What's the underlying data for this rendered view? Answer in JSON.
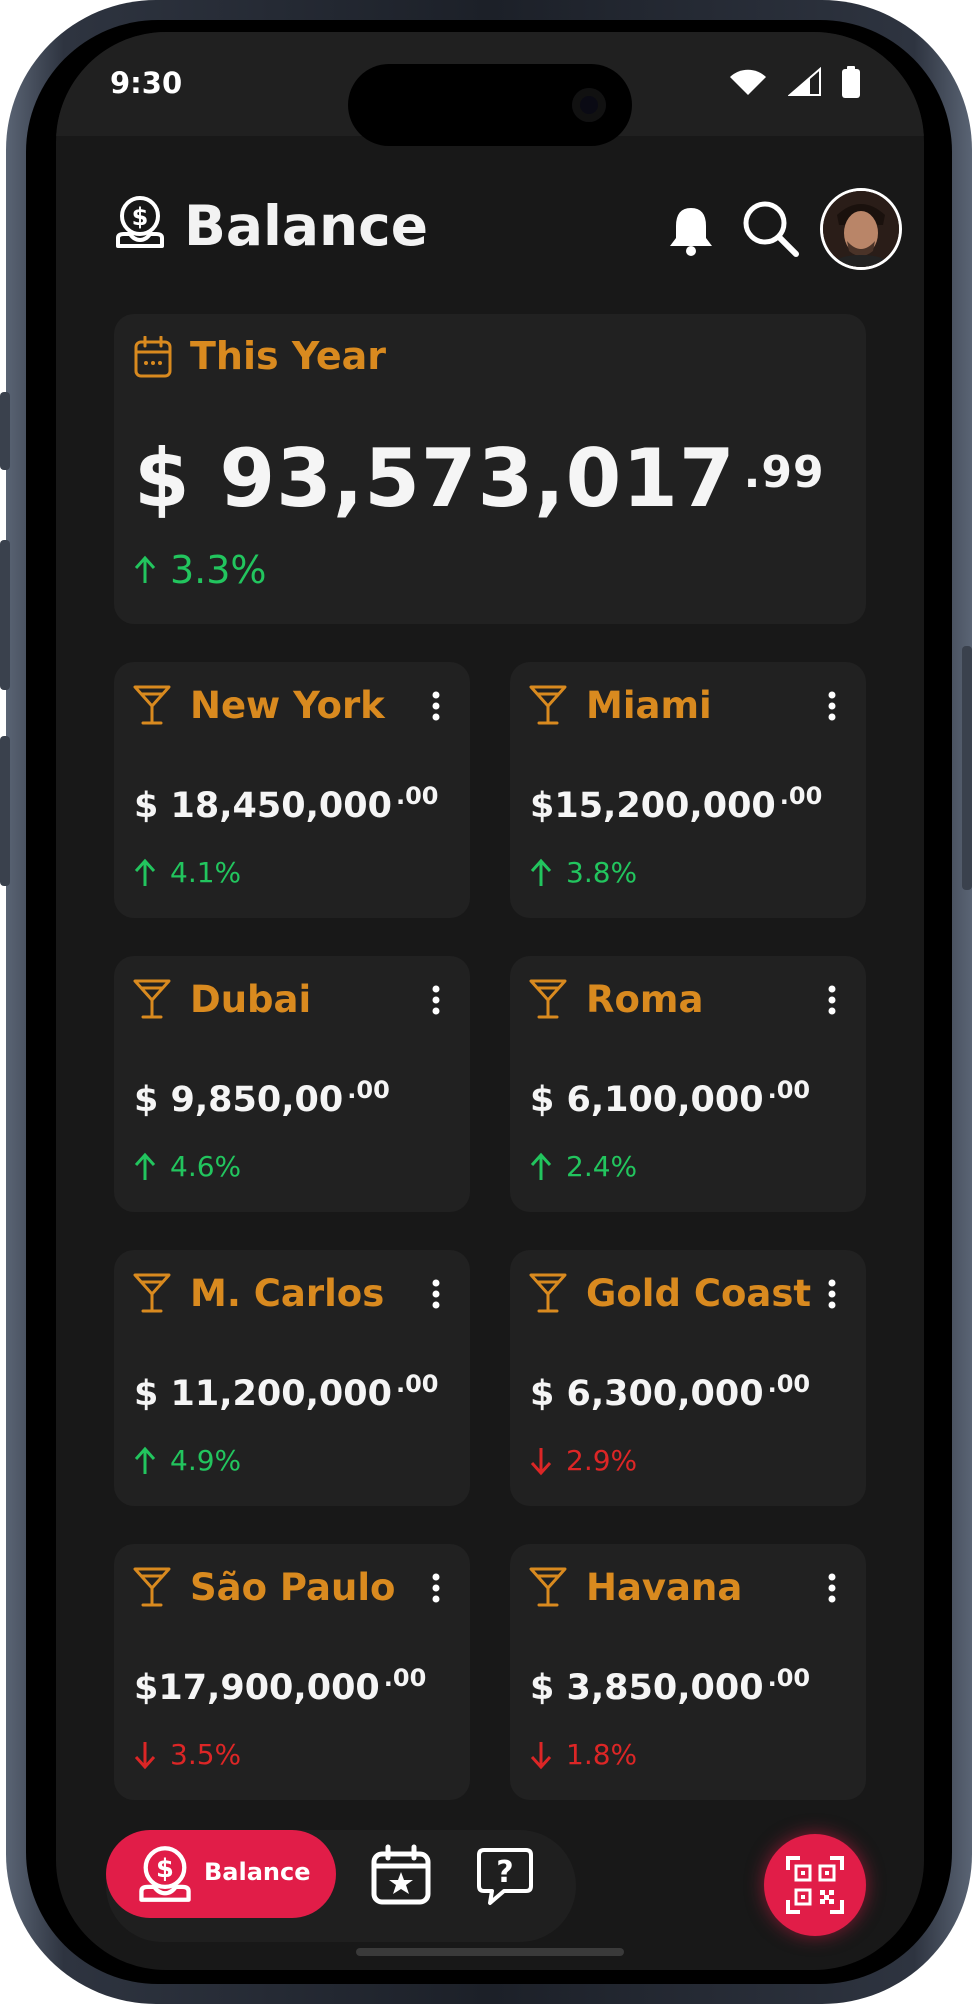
{
  "status": {
    "time": "9:30"
  },
  "header": {
    "title": "Balance"
  },
  "summary": {
    "label": "This Year",
    "amount": "$ 93,573,017",
    "cents": ".99",
    "change": "3.3%",
    "trend": "up"
  },
  "cities": [
    {
      "name": "New York",
      "amount": "$ 18,450,000",
      "cents": ".00",
      "change": "4.1%",
      "trend": "up"
    },
    {
      "name": "Miami",
      "amount": "$15,200,000",
      "cents": ".00",
      "change": "3.8%",
      "trend": "up"
    },
    {
      "name": "Dubai",
      "amount": "$ 9,850,00",
      "cents": ".00",
      "change": "4.6%",
      "trend": "up"
    },
    {
      "name": "Roma",
      "amount": "$ 6,100,000",
      "cents": ".00",
      "change": "2.4%",
      "trend": "up"
    },
    {
      "name": "M. Carlos",
      "amount": "$ 11,200,000",
      "cents": ".00",
      "change": "4.9%",
      "trend": "up"
    },
    {
      "name": "Gold Coast",
      "amount": "$ 6,300,000",
      "cents": ".00",
      "change": "2.9%",
      "trend": "down"
    },
    {
      "name": "São Paulo",
      "amount": "$17,900,000",
      "cents": ".00",
      "change": "3.5%",
      "trend": "down"
    },
    {
      "name": "Havana",
      "amount": "$ 3,850,000",
      "cents": ".00",
      "change": "1.8%",
      "trend": "down"
    }
  ],
  "nav": {
    "active_label": "Balance"
  },
  "colors": {
    "accent": "#e11d48",
    "label_orange": "#d98a1f",
    "positive": "#22c55e",
    "negative": "#dc2626",
    "card": "#212121",
    "background": "#181818"
  },
  "icons": {
    "logo": "money-hand-icon",
    "summary": "calendar-icon",
    "city": "cocktail-glass-icon",
    "menu": "kebab-menu-icon",
    "notifications": "bell-icon",
    "search": "search-icon",
    "nav_calendar": "calendar-star-icon",
    "nav_help": "help-chat-icon",
    "scan": "qr-code-icon"
  }
}
